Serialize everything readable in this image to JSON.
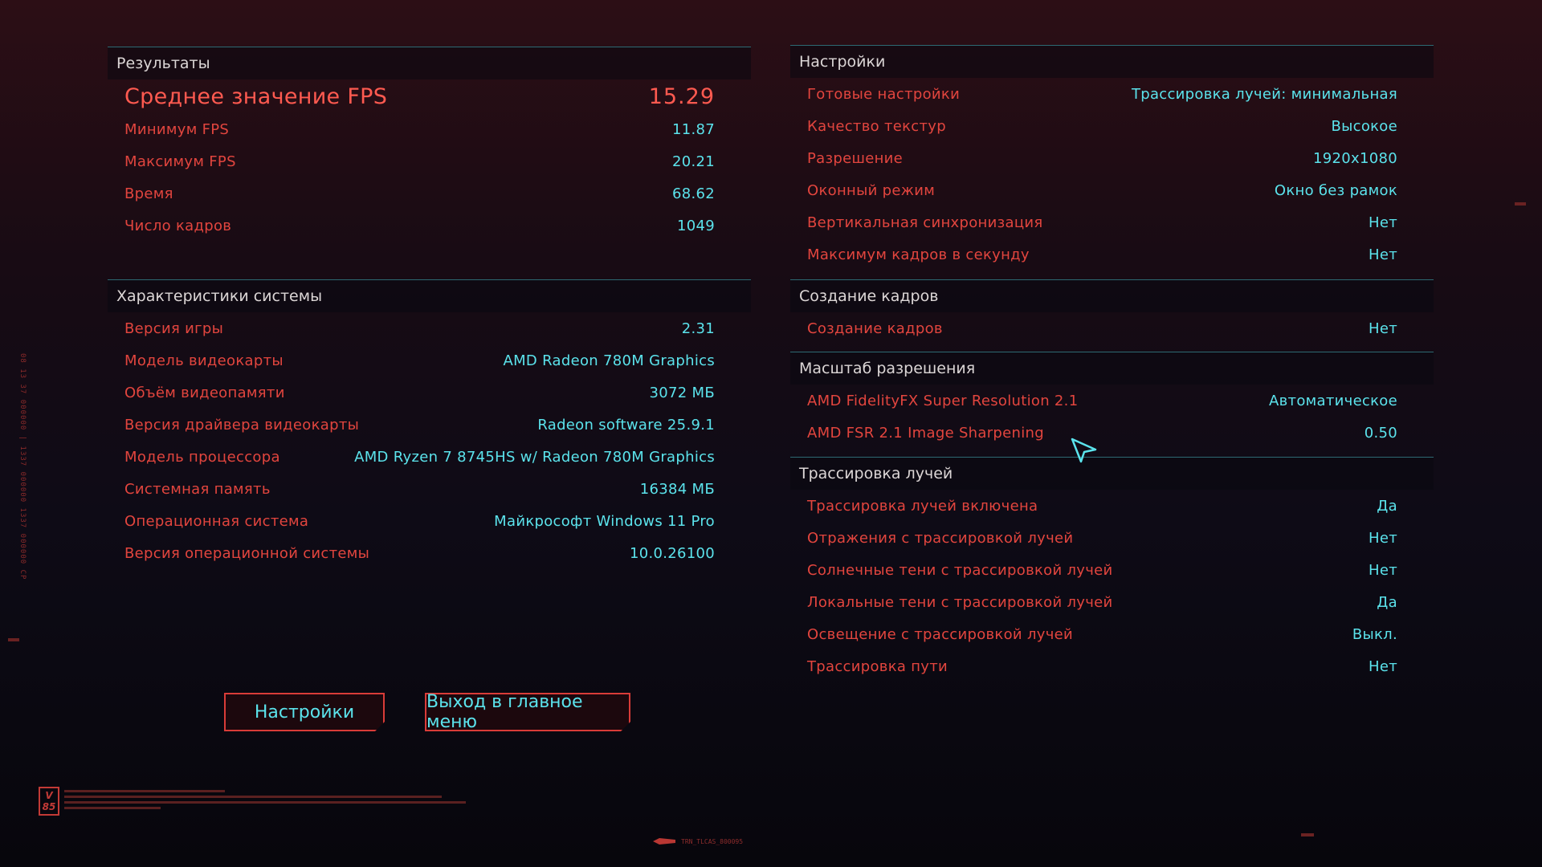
{
  "results": {
    "header": "Результаты",
    "avg_fps": {
      "label": "Среднее значение FPS",
      "value": "15.29"
    },
    "rows": [
      {
        "label": "Минимум FPS",
        "value": "11.87"
      },
      {
        "label": "Максимум FPS",
        "value": "20.21"
      },
      {
        "label": "Время",
        "value": "68.62"
      },
      {
        "label": "Число кадров",
        "value": "1049"
      }
    ]
  },
  "system": {
    "header": "Характеристики системы",
    "rows": [
      {
        "label": "Версия игры",
        "value": "2.31"
      },
      {
        "label": "Модель видеокарты",
        "value": "AMD Radeon 780M Graphics"
      },
      {
        "label": "Объём видеопамяти",
        "value": "3072 МБ"
      },
      {
        "label": "Версия драйвера видеокарты",
        "value": "Radeon software 25.9.1"
      },
      {
        "label": "Модель процессора",
        "value": "AMD Ryzen 7 8745HS w/ Radeon 780M Graphics"
      },
      {
        "label": "Системная память",
        "value": "16384 МБ"
      },
      {
        "label": "Операционная система",
        "value": "Майкрософт Windows 11 Pro"
      },
      {
        "label": "Версия операционной системы",
        "value": "10.0.26100"
      }
    ]
  },
  "settings": {
    "header": "Настройки",
    "rows": [
      {
        "label": "Готовые настройки",
        "value": "Трассировка лучей: минимальная"
      },
      {
        "label": "Качество текстур",
        "value": "Высокое"
      },
      {
        "label": "Разрешение",
        "value": "1920x1080"
      },
      {
        "label": "Оконный режим",
        "value": "Окно без рамок"
      },
      {
        "label": "Вертикальная синхронизация",
        "value": "Нет"
      },
      {
        "label": "Максимум кадров в секунду",
        "value": "Нет"
      }
    ]
  },
  "frame_gen": {
    "header": "Создание кадров",
    "rows": [
      {
        "label": "Создание кадров",
        "value": "Нет"
      }
    ]
  },
  "resolution_scale": {
    "header": "Масштаб разрешения",
    "rows": [
      {
        "label": "AMD FidelityFX Super Resolution 2.1",
        "value": "Автоматическое"
      },
      {
        "label": "AMD FSR 2.1 Image Sharpening",
        "value": "0.50"
      }
    ]
  },
  "ray_tracing": {
    "header": "Трассировка лучей",
    "rows": [
      {
        "label": "Трассировка лучей включена",
        "value": "Да"
      },
      {
        "label": "Отражения с трассировкой лучей",
        "value": "Нет"
      },
      {
        "label": "Солнечные тени с трассировкой лучей",
        "value": "Нет"
      },
      {
        "label": "Локальные тени с трассировкой лучей",
        "value": "Да"
      },
      {
        "label": "Освещение с трассировкой лучей",
        "value": "Выкл."
      },
      {
        "label": "Трассировка пути",
        "value": "Нет"
      }
    ]
  },
  "buttons": {
    "settings": "Настройки",
    "main_menu": "Выход в главное меню"
  },
  "decor": {
    "logo": "V 85",
    "bottom_code": "TRN_TLCAS_800095",
    "side_code": "08 13 37 000000 | 1337 000000 1337 000000 CP"
  },
  "colors": {
    "label_red": "#e2453e",
    "value_cyan": "#5be3ec",
    "header_text": "#dcd6d6",
    "background_top": "#2c0e15",
    "background_bottom": "#07060c"
  }
}
